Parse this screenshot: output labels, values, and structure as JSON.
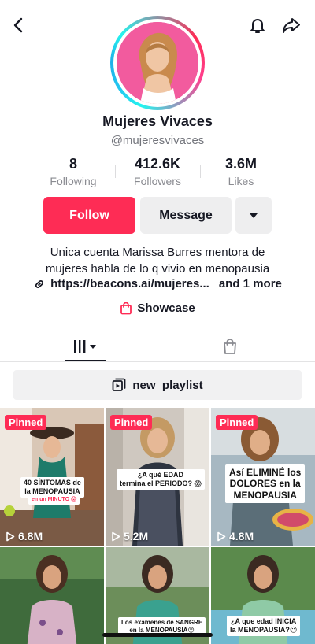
{
  "profile": {
    "name": "Mujeres Vivaces",
    "handle": "@mujeresvivaces",
    "bio_line1": "Unica cuenta Marissa Burres mentora de",
    "bio_line2": "mujeres habla de lo q vivio en menopausia",
    "link_text": "https://beacons.ai/mujeres...",
    "link_more": "and 1 more",
    "showcase_label": "Showcase"
  },
  "stats": [
    {
      "value": "8",
      "label": "Following"
    },
    {
      "value": "412.6K",
      "label": "Followers"
    },
    {
      "value": "3.6M",
      "label": "Likes"
    }
  ],
  "actions": {
    "follow": "Follow",
    "message": "Message"
  },
  "playlist": {
    "label": "new_playlist"
  },
  "videos": [
    {
      "pinned": "Pinned",
      "views": "6.8M",
      "caption": [
        "40 SÍNTOMAS de",
        "la MENOPAUSIA"
      ],
      "caption_sub": "en un MINUTO 😱"
    },
    {
      "pinned": "Pinned",
      "views": "5.2M",
      "caption": [
        "¿A qué EDAD",
        "termina el PERIODO? 😱"
      ]
    },
    {
      "pinned": "Pinned",
      "views": "4.8M",
      "caption": [
        "Así ELIMINÉ los",
        "DOLORES en la",
        "MENOPAUSIA"
      ]
    },
    {
      "caption": [
        "Los exámenes de SANGRE",
        "en la MENOPAUSIA😉"
      ]
    },
    {
      "caption": [
        "¿A que edad INICIA",
        "la MENOPAUSIA?😉"
      ]
    }
  ],
  "colors": {
    "accent": "#fe2c55",
    "ring_cyan": "#25f4ee",
    "secondary_text": "#8a8b91"
  }
}
